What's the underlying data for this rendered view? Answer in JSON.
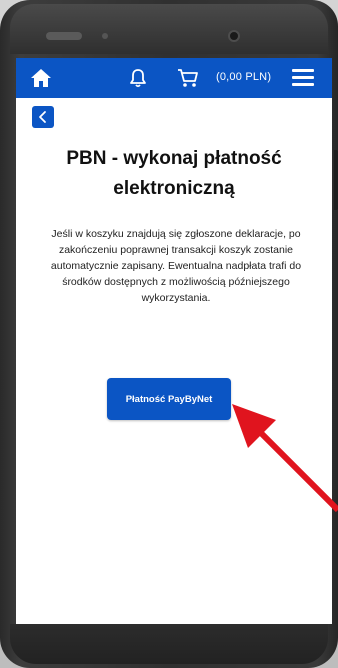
{
  "navbar": {
    "cart_amount": "(0,00 PLN)",
    "icons": [
      "home-icon",
      "bell-icon",
      "cart-icon",
      "menu-icon"
    ],
    "background_color": "#0b55c4"
  },
  "back_button": {
    "icon": "chevron-left-icon"
  },
  "page": {
    "title": "PBN - wykonaj płatność elektroniczną",
    "description": "Jeśli w koszyku znajdują się zgłoszone deklaracje, po zakończeniu poprawnej transakcji koszyk zostanie automatycznie zapisany. Ewentualna nadpłata trafi do środków dostępnych z możliwością późniejszego wykorzystania."
  },
  "payment_button": {
    "label": "Płatność PayByNet"
  },
  "annotation": {
    "arrow_color": "#e0141e"
  }
}
